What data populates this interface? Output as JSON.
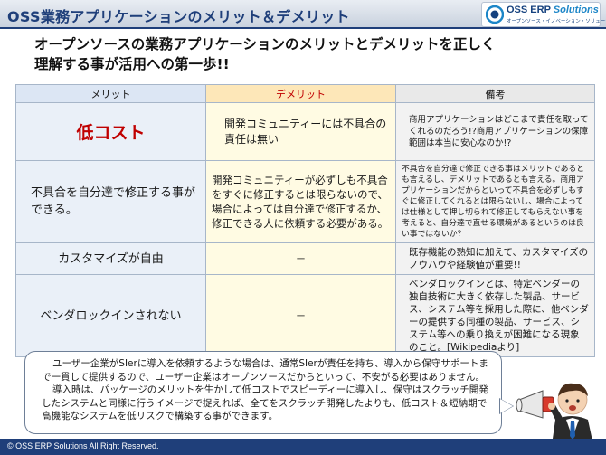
{
  "header": {
    "title": "OSS業務アプリケーションのメリット＆デメリット",
    "logo_main": "OSS ERP ",
    "logo_accent": "Solutions",
    "logo_sub": "オープンソース・イノベーション・ソリューションズ"
  },
  "lead": {
    "line1": "オープンソースの業務アプリケーションのメリットとデメリットを正しく",
    "line2": "理解する事が活用への第一歩!!"
  },
  "table": {
    "headers": {
      "merit": "メリット",
      "demerit": "デメリット",
      "note": "備考"
    },
    "rows": [
      {
        "merit": "低コスト",
        "demerit": "開発コミュニティーには不具合の責任は無い",
        "note": "商用アプリケーションはどこまで責任を取ってくれるのだろう!?商用アプリケーションの保障範囲は本当に安心なのか!?"
      },
      {
        "merit": "不具合を自分達で修正する事ができる。",
        "demerit": "開発コミュニティーが必ずしも不具合をすぐに修正するとは限らないので、場合によっては自分達で修正するか、修正できる人に依頼する必要がある。",
        "note": "不具合を自分達で修正できる事はメリットであるとも言えるし、デメリットであるとも言える。商用アプリケーションだからといって不具合を必ずしもすぐに修正してくれるとは限らないし、場合によっては仕様として押し切られて修正してもらえない事を考えると、自分達で直せる環境があるというのは良い事ではないか？"
      },
      {
        "merit": "カスタマイズが自由",
        "demerit": "－",
        "note": "既存機能の熟知に加えて、カスタマイズのノウハウや経験値が重要!!"
      },
      {
        "merit": "ベンダロックインされない",
        "demerit": "－",
        "note": "ベンダロックインとは、特定ベンダーの独自技術に大きく依存した製品、サービス、システム等を採用した際に、他ベンダーの提供する同種の製品、サービス、システム等への乗り換えが困難になる現象のこと。[Wikipediaより]"
      }
    ]
  },
  "bubble": {
    "para1": "ユーザー企業がSIerに導入を依頼するような場合は、通常SIerが責任を持ち、導入から保守サポートまで一貫して提供するので、ユーザー企業はオープンソースだからといって、不安がる必要はありません。",
    "para2": "導入時は、パッケージのメリットを生かして低コストでスピーディーに導入し、保守はスクラッチ開発したシステムと同様に行うイメージで捉えれば、全てをスクラッチ開発したよりも、低コスト＆短納期で高機能なシステムを低リスクで構築する事ができます。"
  },
  "footer": {
    "copyright": "© OSS ERP Solutions  All Right Reserved."
  },
  "colors": {
    "brand_navy": "#1f3f7a",
    "accent_red": "#c00000",
    "merit_bg": "#eaf0f8",
    "demerit_bg": "#fffbe3"
  },
  "icons": [
    "logo-mark-icon",
    "megaphone-mascot-icon"
  ]
}
